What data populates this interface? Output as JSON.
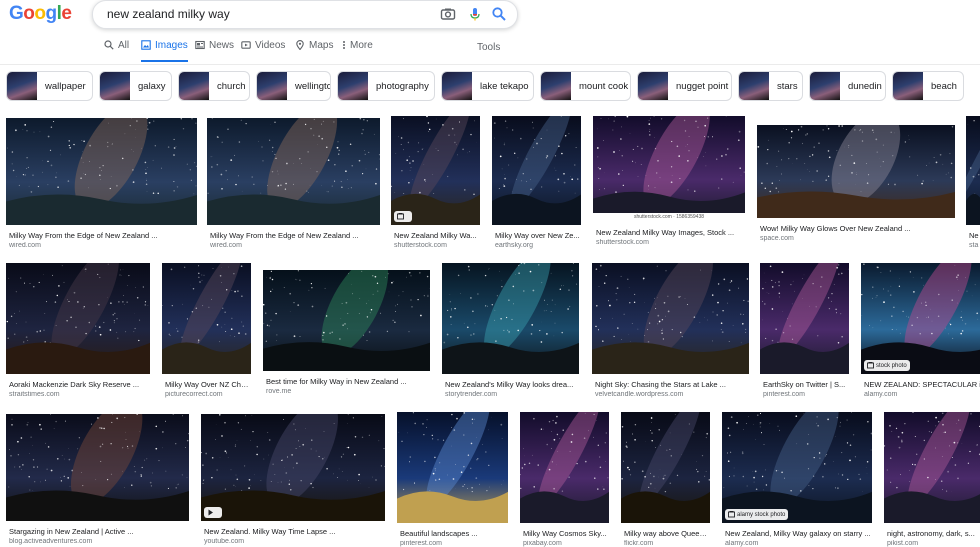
{
  "logo": {
    "letters": [
      "G",
      "o",
      "o",
      "g",
      "l",
      "e"
    ],
    "colors": [
      "#4285f4",
      "#ea4335",
      "#fbbc05",
      "#4285f4",
      "#34a853",
      "#ea4335"
    ]
  },
  "search": {
    "query": "new zealand milky way",
    "icons": [
      "camera-icon",
      "mic-icon",
      "search-icon"
    ]
  },
  "tabs": [
    {
      "label": "All",
      "icon": "search-icon",
      "active": false
    },
    {
      "label": "Images",
      "icon": "image-icon",
      "active": true
    },
    {
      "label": "News",
      "icon": "news-icon",
      "active": false
    },
    {
      "label": "Videos",
      "icon": "video-icon",
      "active": false
    },
    {
      "label": "Maps",
      "icon": "map-pin-icon",
      "active": false
    },
    {
      "label": "More",
      "icon": "more-dots-icon",
      "active": false
    }
  ],
  "tools_label": "Tools",
  "chips": [
    "wallpaper",
    "galaxy",
    "church",
    "wellington",
    "photography",
    "lake tekapo",
    "mount cook",
    "nugget point",
    "stars",
    "dunedin",
    "beach"
  ],
  "results": [
    {
      "caption": "Milky Way From the Edge of New Zealand ...",
      "source": "wired.com"
    },
    {
      "caption": "Milky Way From the Edge of New Zealand ...",
      "source": "wired.com"
    },
    {
      "caption": "New Zealand Milky Wa...",
      "source": "shutterstock.com",
      "badge": true
    },
    {
      "caption": "Milky Way over New Ze...",
      "source": "earthsky.org"
    },
    {
      "caption": "New Zealand Milky Way Images, Stock ...",
      "source": "shutterstock.com",
      "watermark": "shutterstock.com · 1586359438"
    },
    {
      "caption": "Wow! Milky Way Glows Over New Zealand ...",
      "source": "space.com"
    },
    {
      "caption": "Ne",
      "source": "sta"
    },
    {
      "caption": "Aoraki Mackenzie Dark Sky Reserve ...",
      "source": "straitstimes.com"
    },
    {
      "caption": "Milky Way Over NZ Chu...",
      "source": "picturecorrect.com"
    },
    {
      "caption": "Best time for Milky Way in New Zealand ...",
      "source": "rove.me"
    },
    {
      "caption": "New Zealand's Milky Way looks drea...",
      "source": "storytrender.com"
    },
    {
      "caption": "Night Sky: Chasing the Stars at Lake ...",
      "source": "velvetcandle.wordpress.com"
    },
    {
      "caption": "EarthSky on Twitter | S...",
      "source": "pinterest.com"
    },
    {
      "caption": "NEW ZEALAND: SPECTACULAR im",
      "source": "alamy.com",
      "badge": true,
      "badge_text": "stock photo"
    },
    {
      "caption": "Stargazing in New Zealand | Active ...",
      "source": "blog.activeadventures.com"
    },
    {
      "caption": "New Zealand. Milky Way Time Lapse ...",
      "source": "youtube.com",
      "play": true
    },
    {
      "caption": "Beautiful landscapes ...",
      "source": "pinterest.com"
    },
    {
      "caption": "Milky Way Cosmos Sky...",
      "source": "pixabay.com"
    },
    {
      "caption": "Milky way above Queen...",
      "source": "flickr.com"
    },
    {
      "caption": "New Zealand, Milky Way galaxy on starry ...",
      "source": "alamy.com",
      "badge": true,
      "badge_text": "alamy stock photo"
    },
    {
      "caption": "night, astronomy, dark, s...",
      "source": "pikist.com"
    }
  ]
}
